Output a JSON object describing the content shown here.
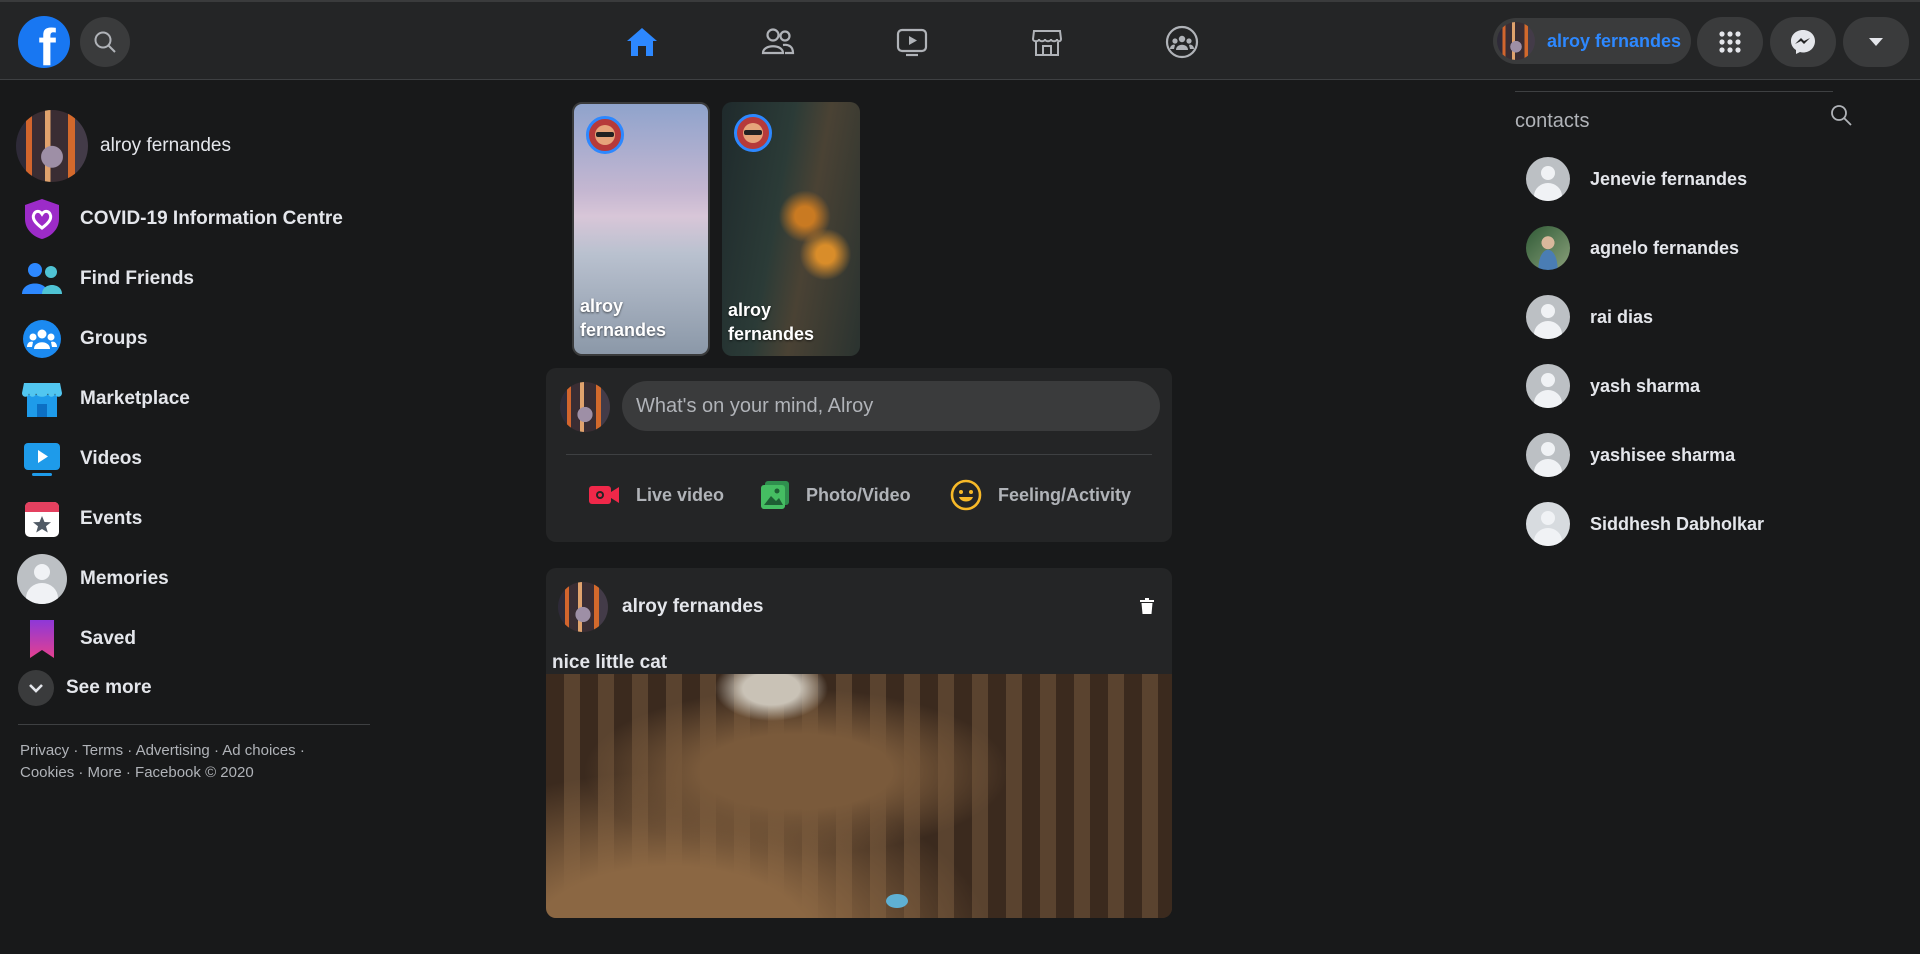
{
  "header": {
    "logo_letter": "f",
    "user_name": "alroy fernandes",
    "nav": [
      "home",
      "friends",
      "watch",
      "marketplace",
      "groups"
    ]
  },
  "sidebar": {
    "profile_name": "alroy fernandes",
    "items": [
      {
        "label": "COVID-19 Information Centre",
        "icon": "covid-heart-icon"
      },
      {
        "label": "Find Friends",
        "icon": "friends-icon"
      },
      {
        "label": "Groups",
        "icon": "groups-icon"
      },
      {
        "label": "Marketplace",
        "icon": "marketplace-icon"
      },
      {
        "label": "Videos",
        "icon": "videos-icon"
      },
      {
        "label": "Events",
        "icon": "events-icon"
      },
      {
        "label": "Memories",
        "icon": "memories-icon"
      },
      {
        "label": "Saved",
        "icon": "saved-icon"
      }
    ],
    "see_more": "See more",
    "footer_line1": "Privacy · Terms · Advertising · Ad choices   ·",
    "footer_line2": "Cookies · More · Facebook © 2020"
  },
  "stories": [
    {
      "name": "alroy fernandes"
    },
    {
      "name": "alroy fernandes"
    }
  ],
  "composer": {
    "placeholder": "What's on your mind, Alroy",
    "actions": [
      "Live video",
      "Photo/Video",
      "Feeling/Activity"
    ]
  },
  "post": {
    "author": "alroy fernandes",
    "text": "nice little cat"
  },
  "contacts": {
    "title": "contacts",
    "list": [
      {
        "name": "Jenevie fernandes"
      },
      {
        "name": "agnelo fernandes"
      },
      {
        "name": "rai dias"
      },
      {
        "name": "yash sharma"
      },
      {
        "name": "yashisee sharma"
      },
      {
        "name": "Siddhesh Dabholkar"
      }
    ]
  },
  "colors": {
    "accent": "#2d88ff",
    "brand": "#1877f2",
    "background": "#18191a",
    "surface": "#242526"
  }
}
